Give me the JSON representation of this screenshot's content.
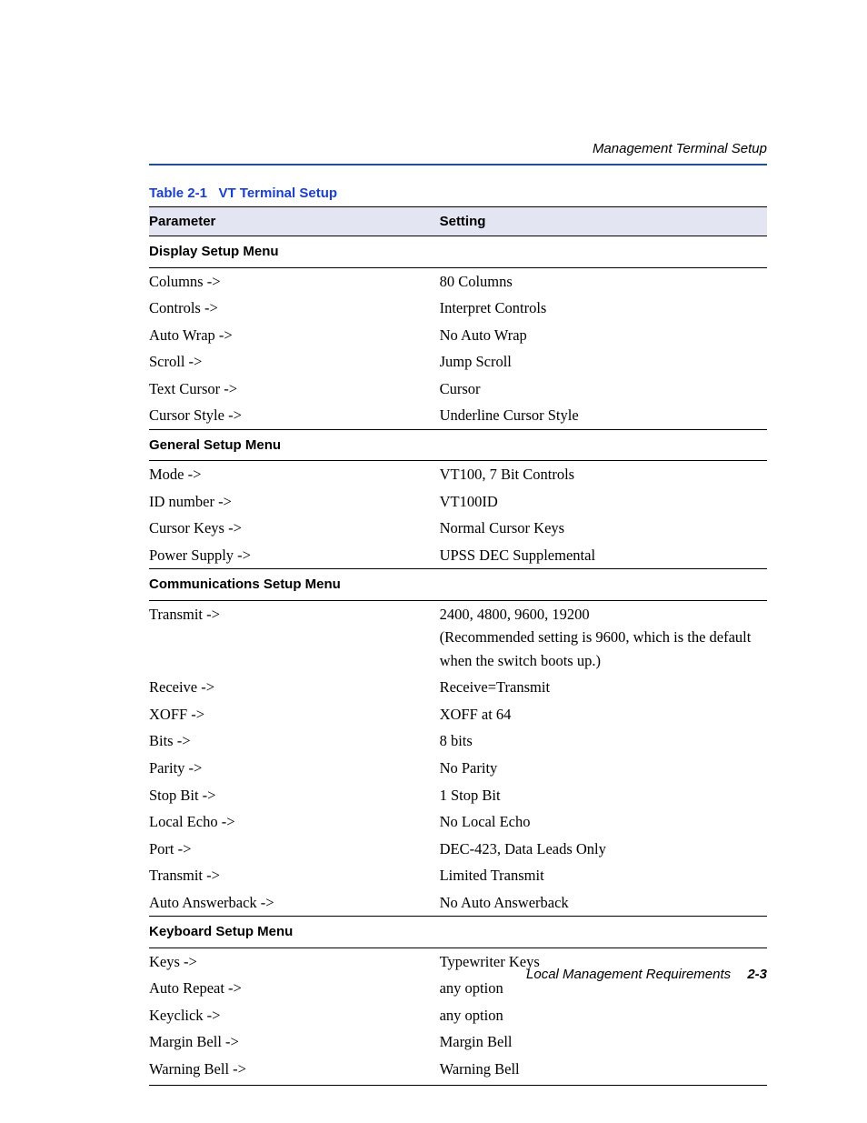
{
  "running_header": "Management Terminal Setup",
  "caption_number": "Table 2-1",
  "caption_title": "VT Terminal Setup",
  "headers": {
    "param": "Parameter",
    "setting": "Setting"
  },
  "sections": [
    {
      "title": "Display Setup Menu",
      "rows": [
        {
          "param": "Columns  ->",
          "setting": "80 Columns"
        },
        {
          "param": "Controls ->",
          "setting": "Interpret Controls"
        },
        {
          "param": "Auto Wrap ->",
          "setting": "No Auto Wrap"
        },
        {
          "param": "Scroll ->",
          "setting": "Jump Scroll"
        },
        {
          "param": "Text Cursor ->",
          "setting": "Cursor"
        },
        {
          "param": "Cursor Style ->",
          "setting": "Underline Cursor Style"
        }
      ]
    },
    {
      "title": "General Setup Menu",
      "rows": [
        {
          "param": "Mode ->",
          "setting": "VT100, 7 Bit Controls"
        },
        {
          "param": "ID number ->",
          "setting": "VT100ID"
        },
        {
          "param": "Cursor Keys ->",
          "setting": "Normal Cursor Keys"
        },
        {
          "param": "Power Supply ->",
          "setting": "UPSS DEC Supplemental"
        }
      ]
    },
    {
      "title": "Communications Setup Menu",
      "rows": [
        {
          "param": "Transmit ->",
          "setting": "2400, 4800, 9600, 19200\n(Recommended setting is 9600, which is the default when the switch boots up.)"
        },
        {
          "param": "Receive ->",
          "setting": "Receive=Transmit"
        },
        {
          "param": "XOFF ->",
          "setting": "XOFF at 64"
        },
        {
          "param": "Bits ->",
          "setting": "8 bits"
        },
        {
          "param": "Parity ->",
          "setting": "No Parity"
        },
        {
          "param": "Stop Bit ->",
          "setting": "1 Stop Bit"
        },
        {
          "param": "Local Echo ->",
          "setting": "No Local Echo"
        },
        {
          "param": "Port ->",
          "setting": "DEC-423, Data Leads Only"
        },
        {
          "param": "Transmit ->",
          "setting": "Limited Transmit"
        },
        {
          "param": "Auto Answerback ->",
          "setting": "No Auto Answerback"
        }
      ]
    },
    {
      "title": "Keyboard Setup Menu",
      "rows": [
        {
          "param": "Keys ->",
          "setting": "Typewriter Keys"
        },
        {
          "param": "Auto Repeat ->",
          "setting": "any option"
        },
        {
          "param": "Keyclick ->",
          "setting": "any option"
        },
        {
          "param": "Margin Bell ->",
          "setting": "Margin Bell"
        },
        {
          "param": "Warning Bell ->",
          "setting": "Warning Bell"
        }
      ]
    }
  ],
  "footer": {
    "title": "Local Management Requirements",
    "page": "2-3"
  }
}
